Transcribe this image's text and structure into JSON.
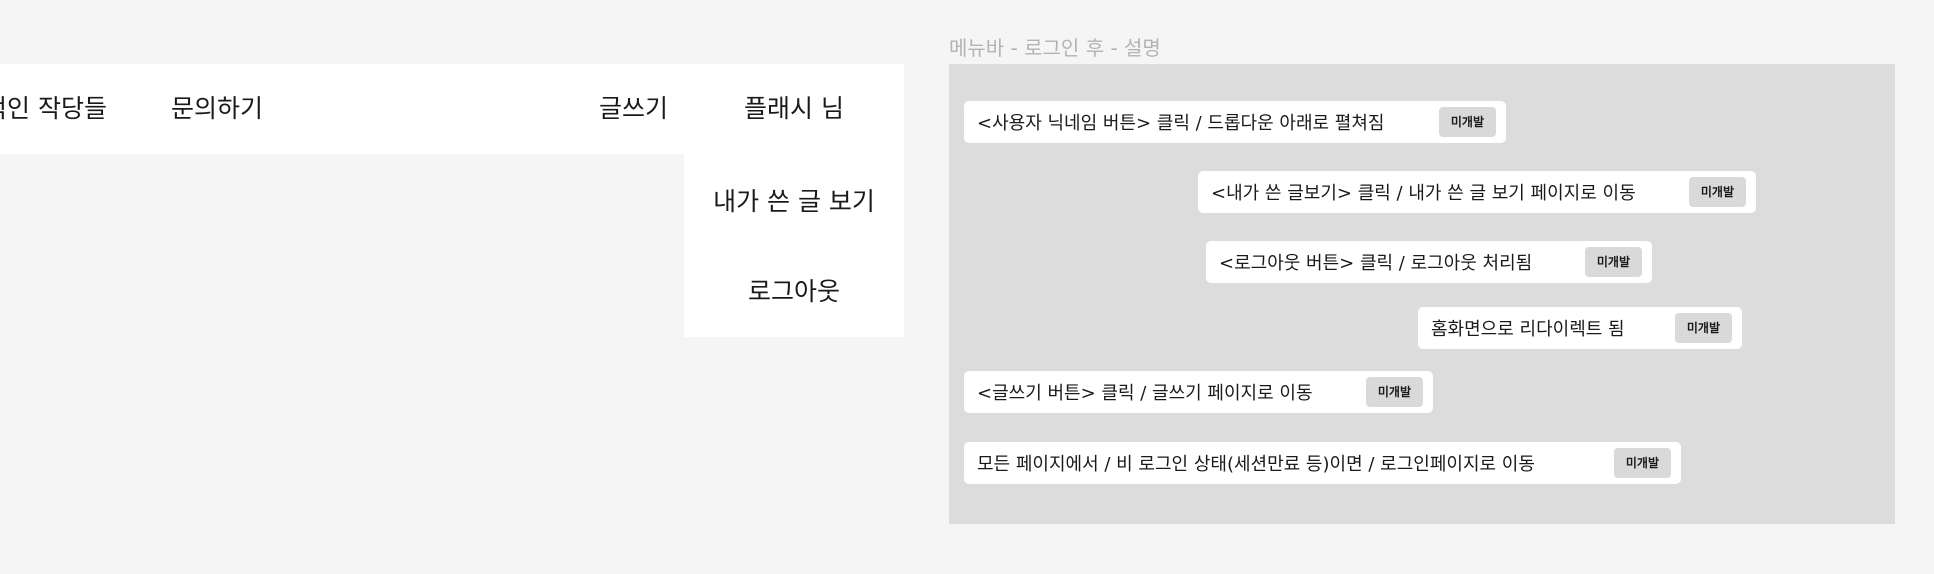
{
  "navbar": {
    "items": [
      {
        "label": "적인 작당들"
      },
      {
        "label": "문의하기"
      },
      {
        "label": "글쓰기"
      },
      {
        "label": "플래시 님"
      }
    ]
  },
  "dropdown": {
    "items": [
      {
        "label": "내가 쓴 글 보기"
      },
      {
        "label": "로그아웃"
      }
    ]
  },
  "description": {
    "title": "메뉴바 - 로그인 후 - 설명",
    "notes": [
      {
        "text": "<사용자 닉네임 버튼> 클릭 / 드롭다운 아래로 펼쳐짐",
        "badge": "미개발"
      },
      {
        "text": "<내가 쓴 글보기> 클릭 / 내가 쓴 글 보기 페이지로 이동",
        "badge": "미개발"
      },
      {
        "text": "<로그아웃 버튼>  클릭 / 로그아웃 처리됨",
        "badge": "미개발"
      },
      {
        "text": "홈화면으로 리다이렉트 됨",
        "badge": "미개발"
      },
      {
        "text": "<글쓰기 버튼>  클릭 / 글쓰기 페이지로 이동",
        "badge": "미개발"
      },
      {
        "text": "모든 페이지에서 / 비 로그인 상태(세션만료 등)이면 / 로그인페이지로 이동",
        "badge": "미개발"
      }
    ]
  }
}
